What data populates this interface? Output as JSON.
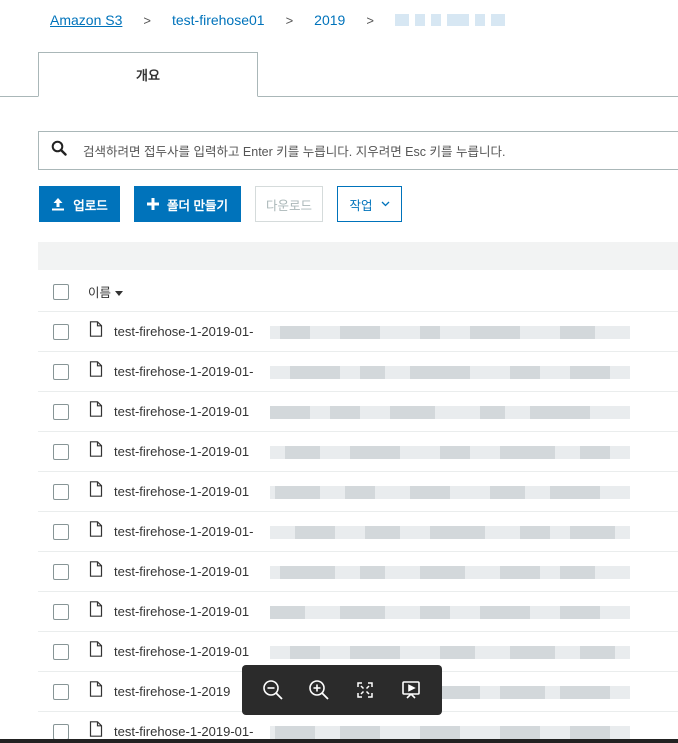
{
  "breadcrumb": {
    "items": [
      "Amazon S3",
      "test-firehose01",
      "2019"
    ],
    "separator": ">"
  },
  "tabs": [
    {
      "label": "개요"
    }
  ],
  "search": {
    "placeholder": "검색하려면 접두사를 입력하고 Enter 키를 누릅니다. 지우려면 Esc 키를 누릅니다."
  },
  "toolbar": {
    "upload_label": "업로드",
    "create_folder_label": "폴더 만들기",
    "download_label": "다운로드",
    "actions_label": "작업"
  },
  "table": {
    "name_header": "이름",
    "rows": [
      "test-firehose-1-2019-01-",
      "test-firehose-1-2019-01-",
      "test-firehose-1-2019-01",
      "test-firehose-1-2019-01",
      "test-firehose-1-2019-01",
      "test-firehose-1-2019-01-",
      "test-firehose-1-2019-01",
      "test-firehose-1-2019-01",
      "test-firehose-1-2019-01",
      "test-firehose-1-2019",
      "test-firehose-1-2019-01-"
    ]
  },
  "icons": {
    "search": "search-icon",
    "upload": "upload-icon",
    "plus": "plus-icon",
    "chevron": "chevron-down-icon",
    "file": "file-icon",
    "zoom_out": "zoom-out-icon",
    "zoom_in": "zoom-in-icon",
    "fit": "fit-screen-icon",
    "present": "present-icon"
  },
  "colors": {
    "accent": "#0073bb",
    "border": "#aab7b8",
    "header_bg": "#f2f3f3"
  }
}
